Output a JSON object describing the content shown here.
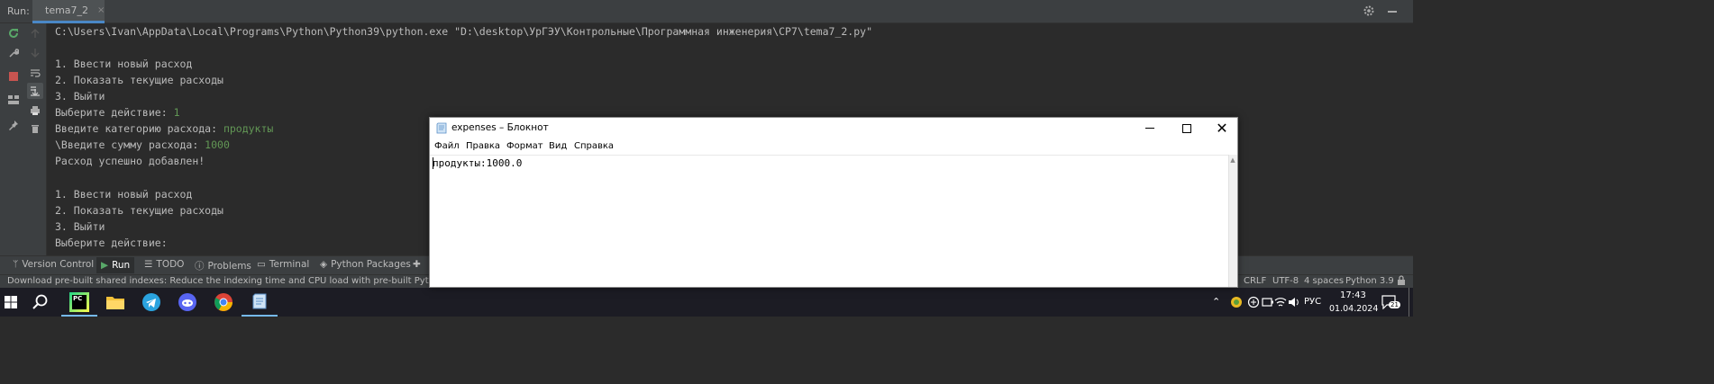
{
  "run": {
    "label": "Run:",
    "tab_name": "tema7_2",
    "tab_close": "×"
  },
  "console": {
    "lines": [
      {
        "text": "C:\\Users\\Ivan\\AppData\\Local\\Programs\\Python\\Python39\\python.exe \"D:\\desktop\\УрГЭУ\\Контрольные\\Программная инженерия\\СР7\\tema7_2.py\"",
        "input": ""
      },
      {
        "text": "",
        "input": ""
      },
      {
        "text": "1. Ввести новый расход",
        "input": ""
      },
      {
        "text": "2. Показать текущие расходы",
        "input": ""
      },
      {
        "text": "3. Выйти",
        "input": ""
      },
      {
        "text": "Выберите действие: ",
        "input": "1"
      },
      {
        "text": "Введите категорию расхода: ",
        "input": "продукты"
      },
      {
        "text": "\\Введите сумму расхода: ",
        "input": "1000"
      },
      {
        "text": "Расход успешно добавлен!",
        "input": ""
      },
      {
        "text": "",
        "input": ""
      },
      {
        "text": "1. Ввести новый расход",
        "input": ""
      },
      {
        "text": "2. Показать текущие расходы",
        "input": ""
      },
      {
        "text": "3. Выйти",
        "input": ""
      },
      {
        "text": "Выберите действие:",
        "input": ""
      }
    ]
  },
  "tool_tabs": [
    "Version Control",
    "Run",
    "TODO",
    "Problems",
    "Terminal",
    "Python Packages"
  ],
  "status": {
    "message": "Download pre-built shared indexes: Reduce the indexing time and CPU load with pre-built Python packages shared indexes",
    "line_sep": "CRLF",
    "encoding": "UTF-8",
    "indent": "4 spaces",
    "interpreter": "Python 3.9"
  },
  "notepad": {
    "title": "expenses – Блокнот",
    "menu": [
      "Файл",
      "Правка",
      "Формат",
      "Вид",
      "Справка"
    ],
    "content": "продукты:1000.0",
    "close_glyph": "✕"
  },
  "taskbar": {
    "lang": "РУС",
    "time": "17:43",
    "date": "01.04.2024",
    "notification_count": "21",
    "pycharm_label": "PC"
  },
  "colors": {
    "ide_bg": "#2b2b2b",
    "panel_bg": "#3c3f41",
    "input_green": "#629755",
    "accent_blue": "#4a88c7"
  }
}
